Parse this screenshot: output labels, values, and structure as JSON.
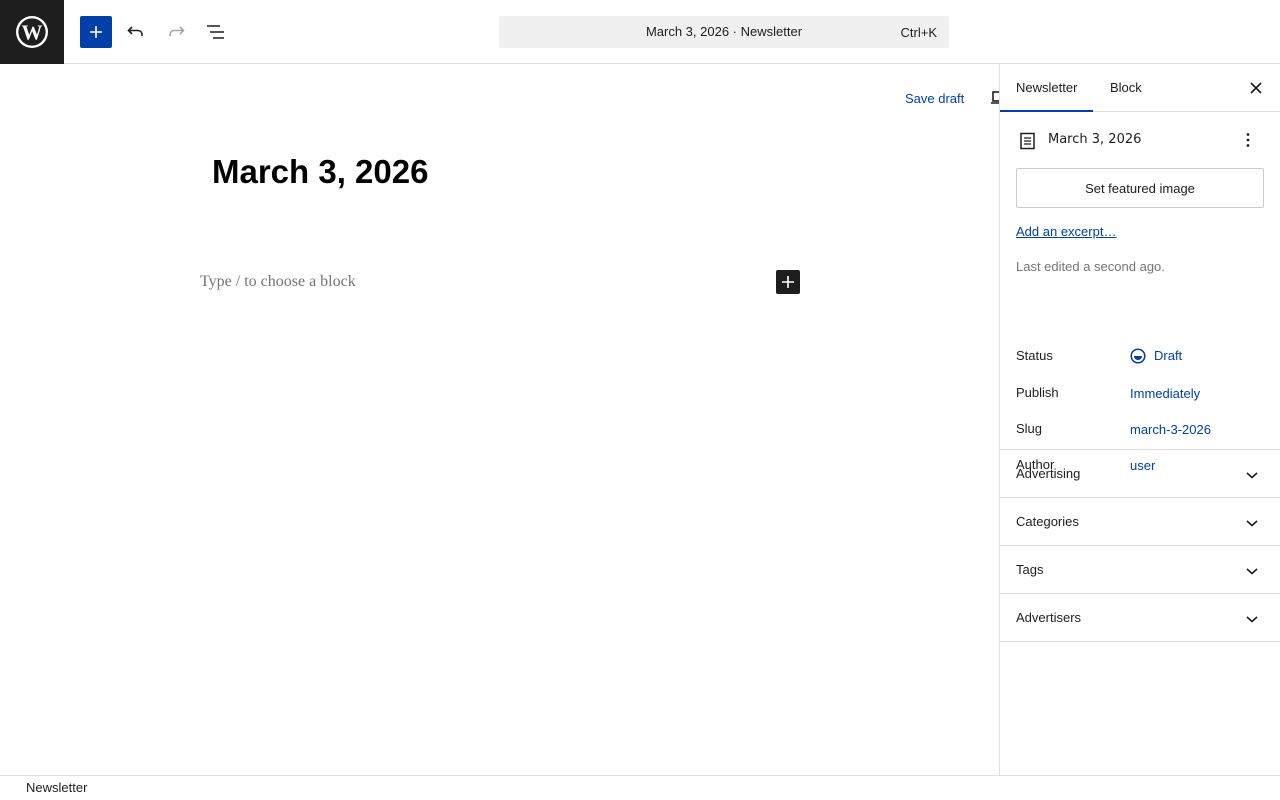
{
  "app": {
    "logo_icon": "wordpress-logo-icon",
    "accent_color": "#0040a8"
  },
  "toolbar": {
    "add_icon": "plus-icon",
    "undo_icon": "undo-icon",
    "redo_icon": "redo-icon",
    "list_view_icon": "list-view-icon"
  },
  "command_bar": {
    "title": "March 3, 2026 · Newsletter",
    "shortcut": "Ctrl+K"
  },
  "editor": {
    "save_draft_label": "Save draft",
    "post_title": "March 3, 2026",
    "block_placeholder": "Type / to choose a block"
  },
  "sidebar": {
    "tabs": [
      {
        "label": "Newsletter",
        "active": true
      },
      {
        "label": "Block",
        "active": false
      }
    ],
    "close_icon": "close-icon",
    "post_name": "March 3, 2026",
    "featured_image_label": "Set featured image",
    "excerpt_link": "Add an excerpt…",
    "last_edited": "Last edited a second ago.",
    "meta": [
      {
        "label": "Status",
        "value": "Draft"
      },
      {
        "label": "Publish",
        "value": "Immediately"
      },
      {
        "label": "Slug",
        "value": "march-3-2026"
      },
      {
        "label": "Author",
        "value": "user"
      }
    ],
    "panels": [
      {
        "title": "Advertising"
      },
      {
        "title": "Categories"
      },
      {
        "title": "Tags"
      },
      {
        "title": "Advertisers"
      }
    ]
  },
  "footer": {
    "breadcrumb": "Newsletter"
  }
}
